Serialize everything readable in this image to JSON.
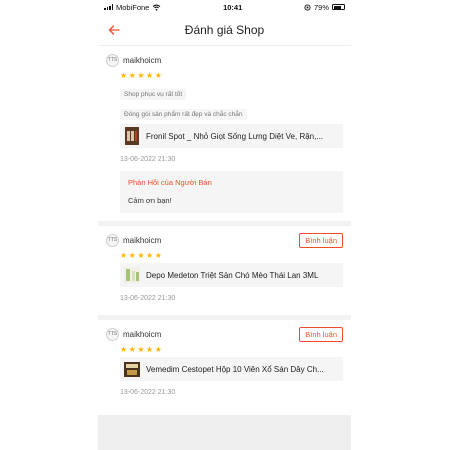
{
  "status_bar": {
    "carrier": "MobiFone",
    "time": "10:41",
    "battery": "79%",
    "battery_level": 0.79
  },
  "header": {
    "title": "Đánh giá Shop"
  },
  "reviews": [
    {
      "username": "maikhoicm",
      "avatar_text": "TTS",
      "rating": 5,
      "tags": [
        "Shop phục vụ rất tốt",
        "Đóng gói sản phẩm rất đẹp và chắc chắn"
      ],
      "product": "Fronil Spot _ Nhỏ Giọt Sống Lưng Diệt Ve, Rận,...",
      "date": "13-06-2022 21:30",
      "reply": {
        "title": "Phản Hồi của Người Bán",
        "text": "Cảm ơn bạn!"
      }
    },
    {
      "username": "maikhoicm",
      "avatar_text": "TTS",
      "rating": 5,
      "comment_button": "Bình luận",
      "product": "Depo Medeton Triệt Sản Chó Mèo Thái Lan 3ML",
      "date": "13-06-2022 21:30"
    },
    {
      "username": "maikhoicm",
      "avatar_text": "TTS",
      "rating": 5,
      "comment_button": "Bình luận",
      "product": "Vemedim Cestopet Hộp 10 Viên Xổ Sán Dây Ch...",
      "date": "13-06-2022 21:30"
    }
  ],
  "colors": {
    "accent": "#ee4d2d",
    "star": "#ffb400"
  }
}
